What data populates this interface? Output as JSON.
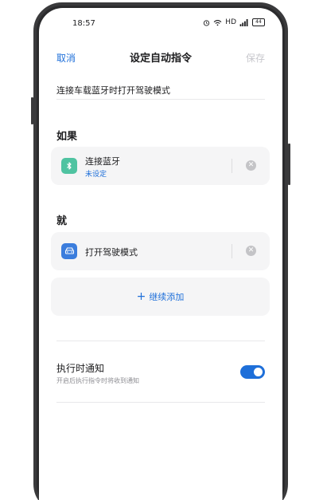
{
  "status_bar": {
    "time": "18:57",
    "network_label": "HD",
    "battery_level": "44"
  },
  "nav": {
    "cancel_label": "取消",
    "title": "设定自动指令",
    "save_label": "保存"
  },
  "command_name": "连接车载蓝牙时打开驾驶模式",
  "if_section": {
    "title": "如果",
    "condition": {
      "icon": "bluetooth-icon",
      "label": "连接蓝牙",
      "sub_label": "未设定"
    }
  },
  "then_section": {
    "title": "就",
    "action": {
      "icon": "car-icon",
      "label": "打开驾驶模式"
    },
    "add_label": "继续添加"
  },
  "notification": {
    "title": "执行时通知",
    "subtitle": "开启后执行指令时将收到通知",
    "enabled": true
  },
  "colors": {
    "accent": "#1e6fd9",
    "bluetooth_tile": "#4fc3a1",
    "car_tile": "#3b7ddd"
  }
}
